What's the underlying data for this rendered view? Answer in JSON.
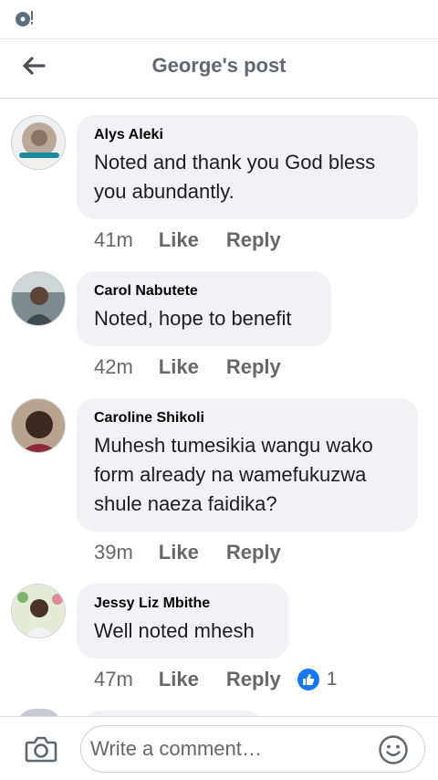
{
  "status_bar": {
    "icon": "disc-alert-icon"
  },
  "header": {
    "title": "George's post",
    "back_icon": "arrow-left-icon"
  },
  "comments": [
    {
      "author": "Alys Aleki",
      "text": "Noted and thank you God bless you abundantly.",
      "time": "41m",
      "like_label": "Like",
      "reply_label": "Reply"
    },
    {
      "author": "Carol Nabutete",
      "text": "Noted, hope to benefit",
      "time": "42m",
      "like_label": "Like",
      "reply_label": "Reply"
    },
    {
      "author": "Caroline Shikoli",
      "text": "Muhesh tumesikia wangu wako form already na wamefukuzwa shule naeza faidika?",
      "time": "39m",
      "like_label": "Like",
      "reply_label": "Reply"
    },
    {
      "author": "Jessy Liz Mbithe",
      "text": "Well noted mhesh",
      "time": "47m",
      "like_label": "Like",
      "reply_label": "Reply",
      "reaction": {
        "icon": "thumbs-up-icon",
        "count": "1"
      }
    }
  ],
  "composer": {
    "placeholder": "Write a comment…",
    "camera_icon": "camera-icon",
    "emoji_icon": "smiley-icon"
  },
  "colors": {
    "accent": "#1877f2",
    "bubble": "#f0f2f5",
    "muted": "#65676b"
  }
}
